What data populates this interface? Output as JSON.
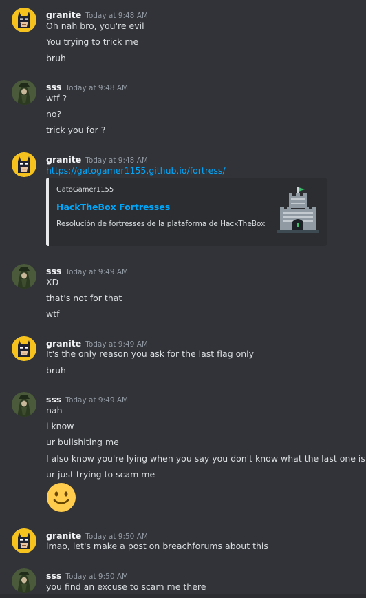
{
  "users": {
    "granite": "granite",
    "sss": "sss"
  },
  "groups": [
    {
      "author": "granite",
      "timestamp": "Today at 9:48 AM",
      "avatar": "batman-icon",
      "messages": [
        "Oh nah bro, you're evil",
        "You trying to trick me",
        "bruh"
      ]
    },
    {
      "author": "sss",
      "timestamp": "Today at 9:48 AM",
      "avatar": "hooded-figure-icon",
      "messages": [
        "wtf ?",
        "no?",
        "trick you for ?"
      ]
    },
    {
      "author": "granite",
      "timestamp": "Today at 9:48 AM",
      "avatar": "batman-icon",
      "messages": [
        "https://gatogamer1155.github.io/fortress/"
      ],
      "embed": {
        "provider": "GatoGamer1155",
        "title": "HackTheBox Fortresses",
        "description": "Resolución de fortresses de la plataforma de HackTheBox",
        "thumbnail_icon": "castle-icon"
      }
    },
    {
      "author": "sss",
      "timestamp": "Today at 9:49 AM",
      "avatar": "hooded-figure-icon",
      "messages": [
        "XD",
        "that's not for that",
        "wtf"
      ]
    },
    {
      "author": "granite",
      "timestamp": "Today at 9:49 AM",
      "avatar": "batman-icon",
      "messages": [
        "It's the only reason you ask for the last flag only",
        "bruh"
      ]
    },
    {
      "author": "sss",
      "timestamp": "Today at 9:49 AM",
      "avatar": "hooded-figure-icon",
      "messages": [
        "nah",
        "i know",
        "ur bullshiting me",
        "I also know you're lying when you say you don't know what the last one is",
        "ur just trying to scam me"
      ],
      "emoji": "slightly-smiling-face-icon"
    },
    {
      "author": "granite",
      "timestamp": "Today at 9:50 AM",
      "avatar": "batman-icon",
      "messages": [
        "lmao, let's make a post on breachforums about this"
      ]
    },
    {
      "author": "sss",
      "timestamp": "Today at 9:50 AM",
      "avatar": "hooded-figure-icon",
      "messages": [
        "you find an excuse to scam me there"
      ]
    }
  ],
  "colors": {
    "background": "#313338",
    "username": "#f2f3f5",
    "timestamp": "#949ba4",
    "text": "#dbdee1",
    "link": "#00a8fc",
    "embed_background": "#2b2d31"
  }
}
